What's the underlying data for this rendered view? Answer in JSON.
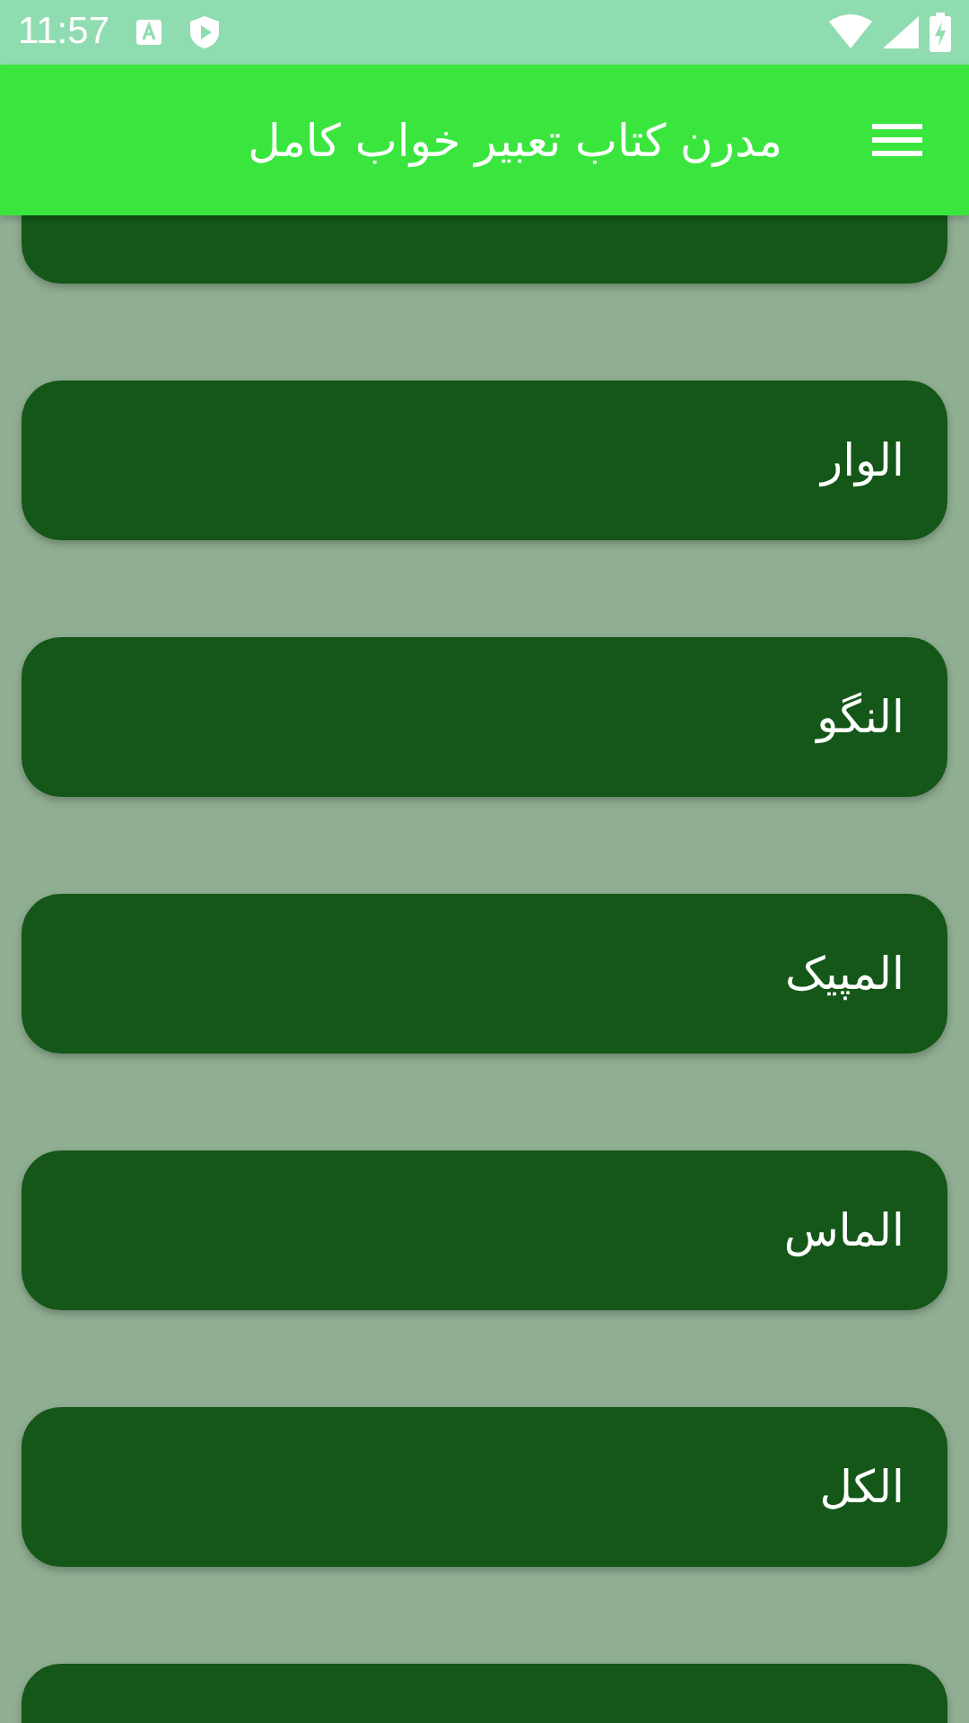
{
  "status_bar": {
    "time": "11:57"
  },
  "app_bar": {
    "title": "مدرن کتاب تعبیر خواب کامل"
  },
  "items": [
    {
      "label": "الوار"
    },
    {
      "label": "النگو"
    },
    {
      "label": "المپیک"
    },
    {
      "label": "الماس"
    },
    {
      "label": "الکل"
    }
  ]
}
